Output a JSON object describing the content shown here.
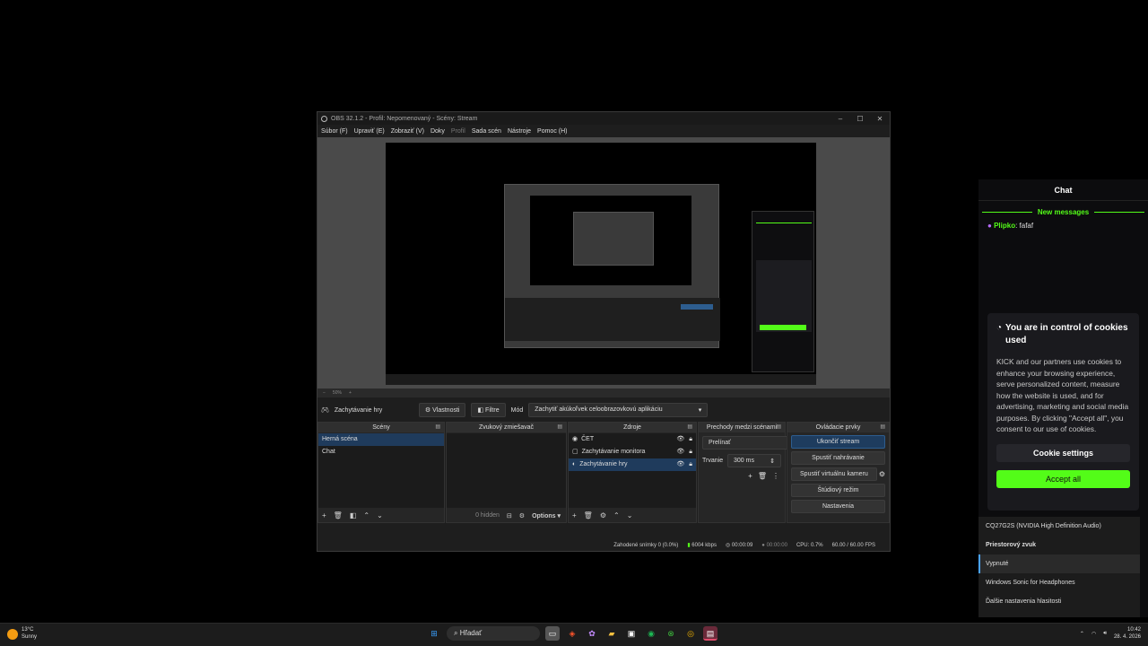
{
  "obs": {
    "title": "OBS 32.1.2 - Profil: Nepomenovaný - Scény: Stream",
    "menu": [
      "Súbor (F)",
      "Upraviť (E)",
      "Zobraziť (V)",
      "Doky",
      "Profil",
      "Sada scén",
      "Nástroje",
      "Pomoc (H)"
    ],
    "zoom": "50%",
    "source_name": "Zachytávanie hry",
    "properties_label": "Vlastnosti",
    "filters_label": "Filtre",
    "mode_label": "Mód",
    "mode_value": "Zachytiť akúkoľvek celoobrazovkovú aplikáciu",
    "docks": {
      "scenes": {
        "title": "Scény",
        "items": [
          "Herná scéna",
          "Chat"
        ]
      },
      "mixer": {
        "title": "Zvukový zmiešavač",
        "hidden": "0 hidden",
        "options": "Options"
      },
      "sources": {
        "title": "Zdroje",
        "items": [
          "ČET",
          "Zachytávanie monitora",
          "Zachytávanie hry"
        ]
      },
      "transitions": {
        "title": "Prechody medzi scénami",
        "type": "Prelínať",
        "duration_label": "Trvanie",
        "duration": "300 ms"
      },
      "controls": {
        "title": "Ovládacie prvky",
        "buttons": [
          "Ukončiť stream",
          "Spustiť nahrávanie",
          "Spustiť virtuálnu kameru",
          "Štúdiový režim",
          "Nastavenia"
        ]
      }
    },
    "status": {
      "dropped": "Zahodené snímky 0 (0.0%)",
      "bitrate": "6004 kbps",
      "stream_time": "00:00:09",
      "rec_time": "00:00:00",
      "cpu": "CPU: 0.7%",
      "fps": "60.00 / 60.00 FPS"
    }
  },
  "chat": {
    "title": "Chat",
    "new_messages": "New messages",
    "message_user": "Plipko",
    "message_text": ": fafaf",
    "cookie_title": "You are in control of cookies used",
    "cookie_body": "KICK and our partners use cookies to enhance your browsing experience, serve personalized content, measure how the website is used, and for advertising, marketing and social media purposes. By clicking \"Accept all\", you consent to our use of cookies.",
    "cookie_settings": "Cookie settings",
    "accept_all": "Accept all"
  },
  "audio_menu": {
    "device": "CQ27G2S (NVIDIA High Definition Audio)",
    "spatial_header": "Priestorový zvuk",
    "off": "Vypnuté",
    "sonic": "Windows Sonic for Headphones",
    "more": "Ďalšie nastavenia hlasitosti"
  },
  "taskbar": {
    "temp": "13°C",
    "weather": "Sunny",
    "search": "Hľadať",
    "time": "10:42",
    "date": "28. 4. 2026"
  },
  "colors": {
    "accent": "#53fc18",
    "obs_select": "#1f3b5c"
  }
}
